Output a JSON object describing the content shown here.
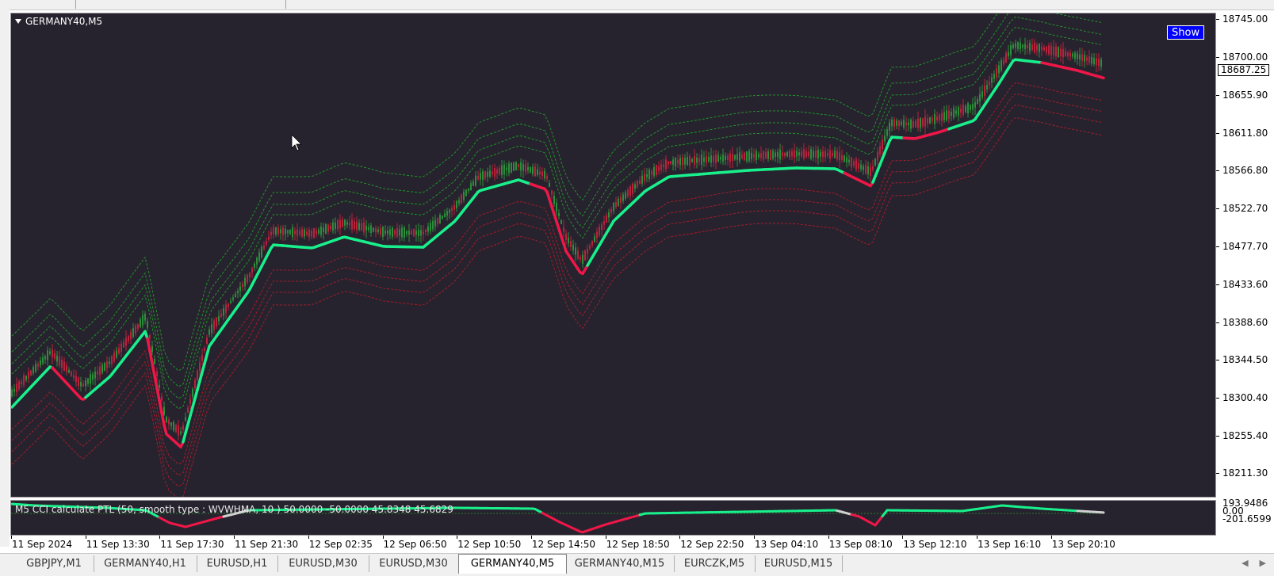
{
  "chart": {
    "title": "GERMANY40,M5",
    "show_button": "Show",
    "current_price": "18687.25",
    "price_labels": [
      "18745.00",
      "18700.00",
      "18655.90",
      "18611.80",
      "18566.80",
      "18522.70",
      "18477.70",
      "18433.60",
      "18388.60",
      "18344.50",
      "18300.40",
      "18255.40",
      "18211.30"
    ],
    "colors": {
      "background": "#27232e",
      "trend_up": "#19f08c",
      "trend_down": "#ee1748",
      "band_up": "#1f9e2a",
      "band_down": "#b01b2a",
      "candle_up": "#2c8d3a",
      "candle_down": "#b8223c"
    },
    "cursor_icon": "mouse-pointer-icon",
    "dropdown_icon": "triangle-down-icon"
  },
  "indicator": {
    "label": "M5 CCI calculate PTL (50, smooth type : WVWHMA, 10 ) 50.0000 -50.0000 45.8348 45.6829",
    "scale_labels": [
      "193.9486",
      "0.00",
      "-201.6599"
    ]
  },
  "time_axis": [
    "11 Sep 2024",
    "11 Sep 13:30",
    "11 Sep 17:30",
    "11 Sep 21:30",
    "12 Sep 02:35",
    "12 Sep 06:50",
    "12 Sep 10:50",
    "12 Sep 14:50",
    "12 Sep 18:50",
    "12 Sep 22:50",
    "13 Sep 04:10",
    "13 Sep 08:10",
    "13 Sep 12:10",
    "13 Sep 16:10",
    "13 Sep 20:10"
  ],
  "tabs": [
    {
      "label": "GBPJPY,M1",
      "active": false
    },
    {
      "label": "GERMANY40,H1",
      "active": false
    },
    {
      "label": "EURUSD,H1",
      "active": false
    },
    {
      "label": "EURUSD,M30",
      "active": false
    },
    {
      "label": "EURUSD,M30",
      "active": false
    },
    {
      "label": "GERMANY40,M5",
      "active": true
    },
    {
      "label": "GERMANY40,M15",
      "active": false
    },
    {
      "label": "EURCZK,M5",
      "active": false
    },
    {
      "label": "EURUSD,M15",
      "active": false
    }
  ],
  "scroll_icons": [
    "scroll-left-icon",
    "scroll-right-icon"
  ]
}
